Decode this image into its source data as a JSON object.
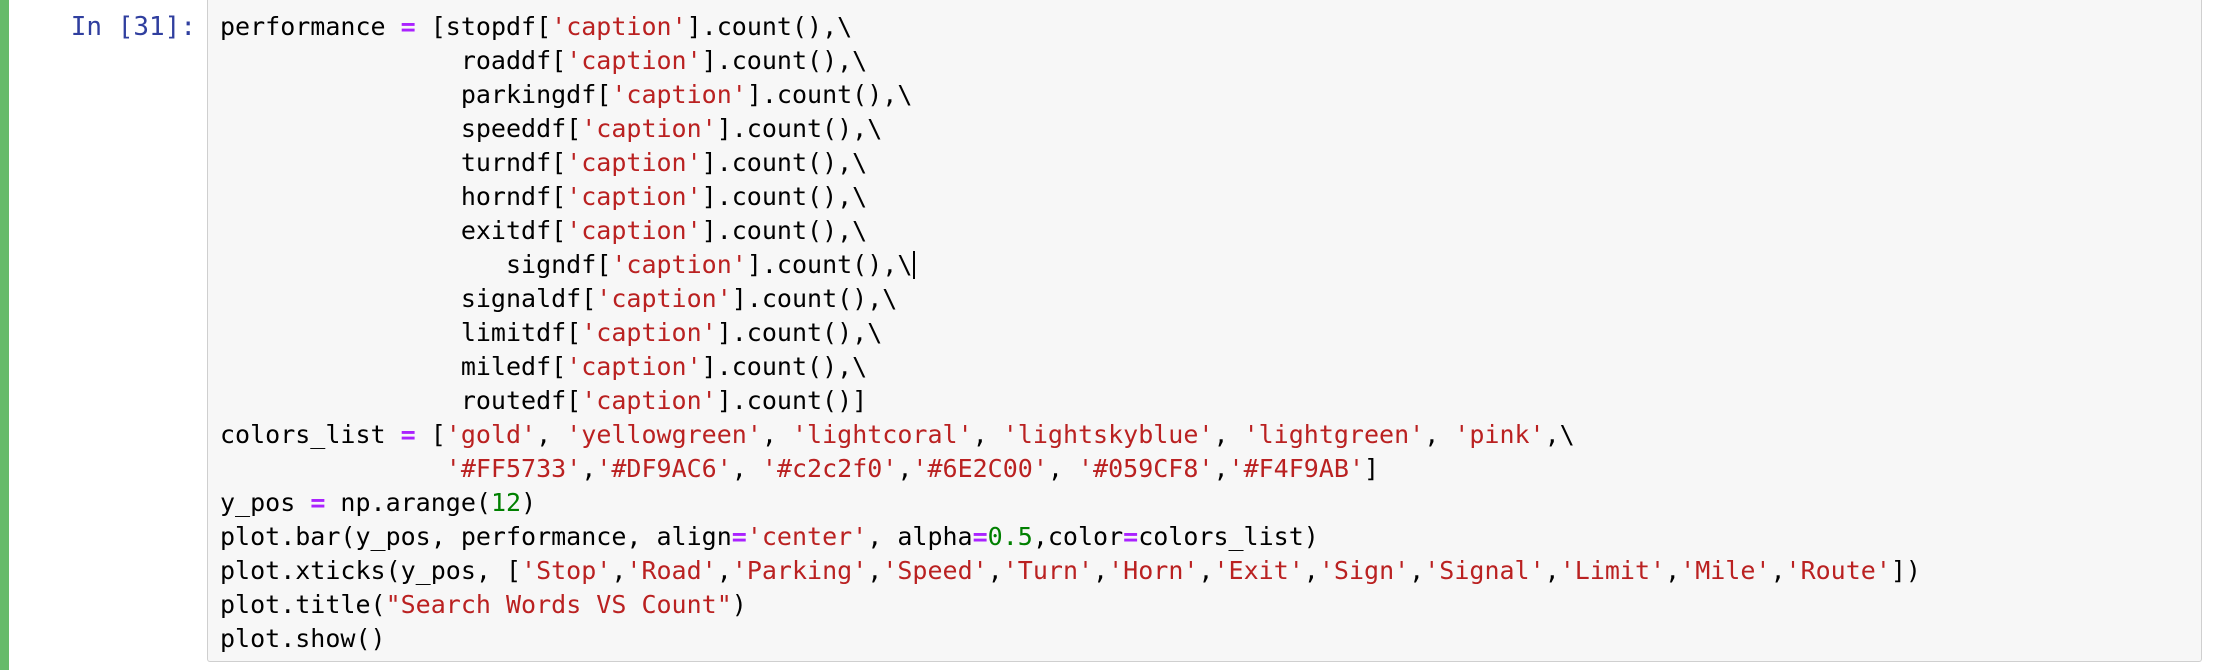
{
  "cell": {
    "prompt": "In [31]:",
    "selected": true,
    "lines": [
      [
        {
          "t": "performance ",
          "c": "plain"
        },
        {
          "t": "=",
          "c": "op"
        },
        {
          "t": " [stopdf[",
          "c": "plain"
        },
        {
          "t": "'caption'",
          "c": "str"
        },
        {
          "t": "].count(),\\",
          "c": "plain"
        }
      ],
      [
        {
          "t": "                roaddf[",
          "c": "plain"
        },
        {
          "t": "'caption'",
          "c": "str"
        },
        {
          "t": "].count(),\\",
          "c": "plain"
        }
      ],
      [
        {
          "t": "                parkingdf[",
          "c": "plain"
        },
        {
          "t": "'caption'",
          "c": "str"
        },
        {
          "t": "].count(),\\",
          "c": "plain"
        }
      ],
      [
        {
          "t": "                speeddf[",
          "c": "plain"
        },
        {
          "t": "'caption'",
          "c": "str"
        },
        {
          "t": "].count(),\\",
          "c": "plain"
        }
      ],
      [
        {
          "t": "                turndf[",
          "c": "plain"
        },
        {
          "t": "'caption'",
          "c": "str"
        },
        {
          "t": "].count(),\\",
          "c": "plain"
        }
      ],
      [
        {
          "t": "                horndf[",
          "c": "plain"
        },
        {
          "t": "'caption'",
          "c": "str"
        },
        {
          "t": "].count(),\\",
          "c": "plain"
        }
      ],
      [
        {
          "t": "                exitdf[",
          "c": "plain"
        },
        {
          "t": "'caption'",
          "c": "str"
        },
        {
          "t": "].count(),\\",
          "c": "plain"
        }
      ],
      [
        {
          "t": "                   signdf[",
          "c": "plain"
        },
        {
          "t": "'caption'",
          "c": "str"
        },
        {
          "t": "].count(),\\",
          "c": "plain"
        },
        {
          "t": "",
          "c": "cursor"
        }
      ],
      [
        {
          "t": "                signaldf[",
          "c": "plain"
        },
        {
          "t": "'caption'",
          "c": "str"
        },
        {
          "t": "].count(),\\",
          "c": "plain"
        }
      ],
      [
        {
          "t": "                limitdf[",
          "c": "plain"
        },
        {
          "t": "'caption'",
          "c": "str"
        },
        {
          "t": "].count(),\\",
          "c": "plain"
        }
      ],
      [
        {
          "t": "                miledf[",
          "c": "plain"
        },
        {
          "t": "'caption'",
          "c": "str"
        },
        {
          "t": "].count(),\\",
          "c": "plain"
        }
      ],
      [
        {
          "t": "                routedf[",
          "c": "plain"
        },
        {
          "t": "'caption'",
          "c": "str"
        },
        {
          "t": "].count()]",
          "c": "plain"
        }
      ],
      [
        {
          "t": "colors_list ",
          "c": "plain"
        },
        {
          "t": "=",
          "c": "op"
        },
        {
          "t": " [",
          "c": "plain"
        },
        {
          "t": "'gold'",
          "c": "str"
        },
        {
          "t": ", ",
          "c": "plain"
        },
        {
          "t": "'yellowgreen'",
          "c": "str"
        },
        {
          "t": ", ",
          "c": "plain"
        },
        {
          "t": "'lightcoral'",
          "c": "str"
        },
        {
          "t": ", ",
          "c": "plain"
        },
        {
          "t": "'lightskyblue'",
          "c": "str"
        },
        {
          "t": ", ",
          "c": "plain"
        },
        {
          "t": "'lightgreen'",
          "c": "str"
        },
        {
          "t": ", ",
          "c": "plain"
        },
        {
          "t": "'pink'",
          "c": "str"
        },
        {
          "t": ",\\",
          "c": "plain"
        }
      ],
      [
        {
          "t": "               ",
          "c": "plain"
        },
        {
          "t": "'#FF5733'",
          "c": "str"
        },
        {
          "t": ",",
          "c": "plain"
        },
        {
          "t": "'#DF9AC6'",
          "c": "str"
        },
        {
          "t": ", ",
          "c": "plain"
        },
        {
          "t": "'#c2c2f0'",
          "c": "str"
        },
        {
          "t": ",",
          "c": "plain"
        },
        {
          "t": "'#6E2C00'",
          "c": "str"
        },
        {
          "t": ", ",
          "c": "plain"
        },
        {
          "t": "'#059CF8'",
          "c": "str"
        },
        {
          "t": ",",
          "c": "plain"
        },
        {
          "t": "'#F4F9AB'",
          "c": "str"
        },
        {
          "t": "]",
          "c": "plain"
        }
      ],
      [
        {
          "t": "y_pos ",
          "c": "plain"
        },
        {
          "t": "=",
          "c": "op"
        },
        {
          "t": " np.arange(",
          "c": "plain"
        },
        {
          "t": "12",
          "c": "num"
        },
        {
          "t": ")",
          "c": "plain"
        }
      ],
      [
        {
          "t": "plot.bar(y_pos, performance, align",
          "c": "plain"
        },
        {
          "t": "=",
          "c": "op"
        },
        {
          "t": "'center'",
          "c": "str"
        },
        {
          "t": ", alpha",
          "c": "plain"
        },
        {
          "t": "=",
          "c": "op"
        },
        {
          "t": "0.5",
          "c": "num"
        },
        {
          "t": ",color",
          "c": "plain"
        },
        {
          "t": "=",
          "c": "op"
        },
        {
          "t": "colors_list)",
          "c": "plain"
        }
      ],
      [
        {
          "t": "plot.xticks(y_pos, [",
          "c": "plain"
        },
        {
          "t": "'Stop'",
          "c": "str"
        },
        {
          "t": ",",
          "c": "plain"
        },
        {
          "t": "'Road'",
          "c": "str"
        },
        {
          "t": ",",
          "c": "plain"
        },
        {
          "t": "'Parking'",
          "c": "str"
        },
        {
          "t": ",",
          "c": "plain"
        },
        {
          "t": "'Speed'",
          "c": "str"
        },
        {
          "t": ",",
          "c": "plain"
        },
        {
          "t": "'Turn'",
          "c": "str"
        },
        {
          "t": ",",
          "c": "plain"
        },
        {
          "t": "'Horn'",
          "c": "str"
        },
        {
          "t": ",",
          "c": "plain"
        },
        {
          "t": "'Exit'",
          "c": "str"
        },
        {
          "t": ",",
          "c": "plain"
        },
        {
          "t": "'Sign'",
          "c": "str"
        },
        {
          "t": ",",
          "c": "plain"
        },
        {
          "t": "'Signal'",
          "c": "str"
        },
        {
          "t": ",",
          "c": "plain"
        },
        {
          "t": "'Limit'",
          "c": "str"
        },
        {
          "t": ",",
          "c": "plain"
        },
        {
          "t": "'Mile'",
          "c": "str"
        },
        {
          "t": ",",
          "c": "plain"
        },
        {
          "t": "'Route'",
          "c": "str"
        },
        {
          "t": "])",
          "c": "plain"
        }
      ],
      [
        {
          "t": "plot.title(",
          "c": "plain"
        },
        {
          "t": "\"Search Words VS Count\"",
          "c": "str"
        },
        {
          "t": ")",
          "c": "plain"
        }
      ],
      [
        {
          "t": "plot.show()",
          "c": "plain"
        }
      ]
    ]
  }
}
